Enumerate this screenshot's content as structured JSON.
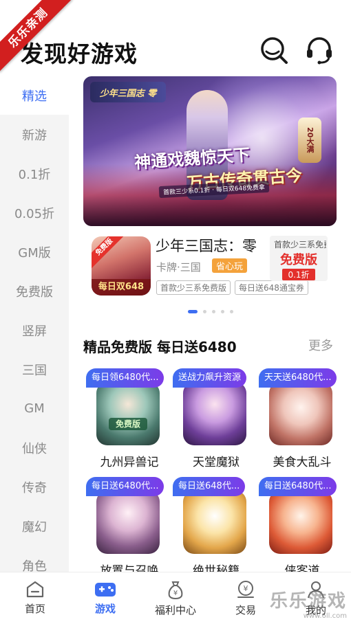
{
  "corner_ribbon": "乐乐亲测",
  "header": {
    "title": "发现好游戏",
    "search_icon": "search-icon",
    "support_icon": "headset-icon"
  },
  "sidebar": {
    "items": [
      {
        "label": "精选",
        "active": true
      },
      {
        "label": "新游"
      },
      {
        "label": "0.1折"
      },
      {
        "label": "0.05折"
      },
      {
        "label": "GM版"
      },
      {
        "label": "免费版"
      },
      {
        "label": "竖屏"
      },
      {
        "label": "三国"
      },
      {
        "label": "GM"
      },
      {
        "label": "仙侠"
      },
      {
        "label": "传奇"
      },
      {
        "label": "魔幻"
      },
      {
        "label": "角色"
      }
    ]
  },
  "banner": {
    "logo": "少年三国志 零",
    "slogan_line1": "神通戏魏惊天下",
    "slogan_line2": "万古传奇贯古今",
    "subline": "首款三少系0.1折 · 每日双648免费拿",
    "badge": "20大满",
    "carousel_total": 5,
    "carousel_active": 0
  },
  "featured": {
    "icon_corner": "免费版",
    "icon_bottom": "每日双648",
    "name": "少年三国志：零",
    "category": "卡牌·三国",
    "tag": "省心玩",
    "tags": [
      "首款少三系免费版",
      "每日送648通宝券"
    ],
    "card_top": "首款少三系免费版",
    "free_big": "免费版",
    "free_small": "0.1折"
  },
  "section": {
    "title": "精品免费版 每日送6480",
    "more": "更多"
  },
  "games": [
    {
      "ribbon": "每日领6480代...",
      "name": "九州异兽记",
      "icon": "fantasy-warrior-icon",
      "colors": [
        "#d9e9e4",
        "#6c9c8f",
        "#2e4a45"
      ],
      "badge": "免费版"
    },
    {
      "ribbon": "送战力飙升资源",
      "name": "天堂魔狱",
      "icon": "purple-maiden-icon",
      "colors": [
        "#e7d2f2",
        "#a070c8",
        "#3e2358"
      ],
      "badge": ""
    },
    {
      "ribbon": "天天送6480代...",
      "name": "美食大乱斗",
      "icon": "chef-girl-icon",
      "colors": [
        "#fbe6e0",
        "#e0a59a",
        "#8a3c36"
      ],
      "badge": ""
    },
    {
      "ribbon": "每日送6480代...",
      "name": "放置与召唤",
      "icon": "elf-mage-icon",
      "colors": [
        "#f4e4ef",
        "#c89bbc",
        "#5a3a5c"
      ],
      "badge": ""
    },
    {
      "ribbon": "每日送648代...",
      "name": "绝世秘籍",
      "icon": "white-hair-hero-icon",
      "colors": [
        "#fff3d6",
        "#e7b866",
        "#8a5a1c"
      ],
      "badge": ""
    },
    {
      "ribbon": "每日送6480代...",
      "name": "侠客道",
      "icon": "red-hair-girl-icon",
      "colors": [
        "#fde7d8",
        "#f08a5a",
        "#a02c20"
      ],
      "badge": ""
    }
  ],
  "bottom_nav": [
    {
      "label": "首页",
      "icon": "home-icon"
    },
    {
      "label": "游戏",
      "icon": "gamepad-icon",
      "active": true
    },
    {
      "label": "福利中心",
      "icon": "money-bag-icon"
    },
    {
      "label": "交易",
      "icon": "trade-icon"
    },
    {
      "label": "我的",
      "icon": "user-icon"
    }
  ],
  "watermark": {
    "big": "乐乐游戏",
    "small": "www.6ll.com"
  },
  "colors": {
    "accent": "#3d6ef2",
    "ribbon": "#d21f1f",
    "tag_orange": "#f4a23b",
    "free_red": "#e3302c"
  }
}
